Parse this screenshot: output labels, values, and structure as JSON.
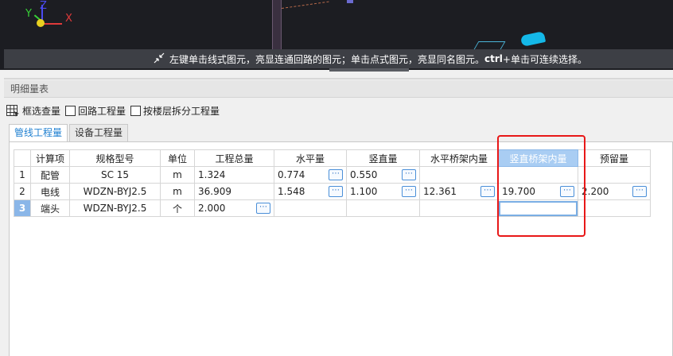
{
  "viewport": {
    "axes": {
      "x": "X",
      "y": "Y",
      "z": "Z"
    },
    "hint_icon": "collapse-arrows-icon",
    "hint_before": "左键单击线式图元，亮显连通回路的图元；单击点式图元，亮显同名图元。",
    "hint_key": "ctrl",
    "hint_after": "+单击可连续选择。"
  },
  "panel": {
    "title": "明细量表",
    "options": {
      "box_select": "框选查量",
      "loop_qty": "回路工程量",
      "by_floor": "按楼层拆分工程量"
    },
    "tabs": [
      {
        "label": "管线工程量",
        "active": true
      },
      {
        "label": "设备工程量",
        "active": false
      }
    ]
  },
  "table": {
    "columns": [
      "",
      "计算项",
      "规格型号",
      "单位",
      "工程总量",
      "水平量",
      "竖直量",
      "水平桥架内量",
      "竖直桥架内量",
      "预留量"
    ],
    "selected_column": "竖直桥架内量",
    "rows": [
      {
        "num": "1",
        "item": "配管",
        "spec": "SC 15",
        "unit": "m",
        "total": "1.324",
        "horizontal": "0.774",
        "vertical": "0.550",
        "h_tray": "",
        "v_tray": "",
        "reserve": ""
      },
      {
        "num": "2",
        "item": "电线",
        "spec": "WDZN-BYJ2.5",
        "unit": "m",
        "total": "36.909",
        "horizontal": "1.548",
        "vertical": "1.100",
        "h_tray": "12.361",
        "v_tray": "19.700",
        "reserve": "2.200"
      },
      {
        "num": "3",
        "item": "端头",
        "spec": "WDZN-BYJ2.5",
        "unit": "个",
        "total": "2.000",
        "horizontal": "",
        "vertical": "",
        "h_tray": "",
        "v_tray": "",
        "reserve": ""
      }
    ],
    "more_button": "⋯"
  },
  "colors": {
    "accent": "#1e7fd0",
    "highlight": "#e81818",
    "selected_header": "#a9cdf3"
  }
}
